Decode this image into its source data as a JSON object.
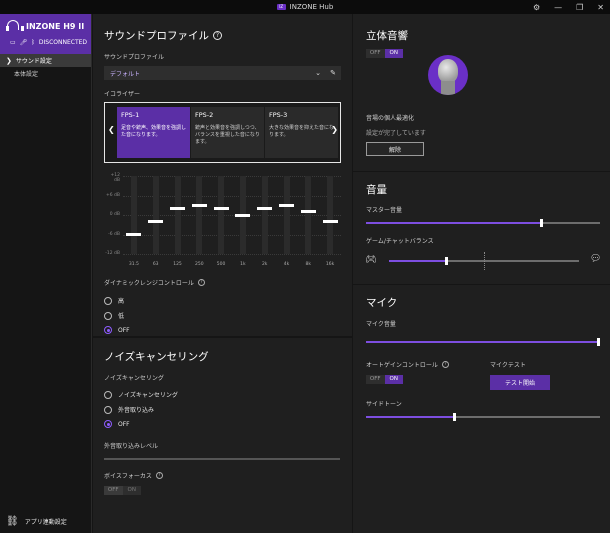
{
  "window": {
    "title": "INZONE Hub",
    "controls": [
      "⚙",
      "—",
      "❐",
      "✕"
    ]
  },
  "sidebar": {
    "device_name": "INZONE H9 II",
    "status": "DISCONNECTED",
    "nav": [
      {
        "label": "サウンド設定",
        "active": true
      },
      {
        "label": "本体設定",
        "active": false
      }
    ],
    "app_link": "アプリ連動設定"
  },
  "sound_profile": {
    "title": "サウンドプロファイル",
    "profile_label": "サウンドプロファイル",
    "profile_value": "デフォルト",
    "eq_label": "イコライザー",
    "presets": [
      {
        "name": "FPS-1",
        "desc": "足音や銃声、効果音を強調した音になります。",
        "active": true
      },
      {
        "name": "FPS-2",
        "desc": "銃声と効果音を強調しつつ、バランスを重視した音になります。",
        "active": false
      },
      {
        "name": "FPS-3",
        "desc": "大きな効果音を抑えた音になります。",
        "active": false
      }
    ],
    "eq": {
      "db_labels": [
        "+12 dB",
        "+6 dB",
        "0 dB",
        "-6 dB",
        "-12 dB"
      ],
      "bands": [
        {
          "freq": "31.5",
          "gain": -6
        },
        {
          "freq": "63",
          "gain": -2
        },
        {
          "freq": "125",
          "gain": 2
        },
        {
          "freq": "250",
          "gain": 3
        },
        {
          "freq": "500",
          "gain": 2
        },
        {
          "freq": "1k",
          "gain": 0
        },
        {
          "freq": "2k",
          "gain": 2
        },
        {
          "freq": "4k",
          "gain": 3
        },
        {
          "freq": "8k",
          "gain": 1
        },
        {
          "freq": "16k",
          "gain": -2
        }
      ]
    },
    "drc_label": "ダイナミックレンジコントロール",
    "drc_options": [
      {
        "label": "高",
        "checked": false
      },
      {
        "label": "低",
        "checked": false
      },
      {
        "label": "OFF",
        "checked": true
      }
    ]
  },
  "noise": {
    "title": "ノイズキャンセリング",
    "label": "ノイズキャンセリング",
    "options": [
      {
        "label": "ノイズキャンセリング",
        "checked": false
      },
      {
        "label": "外音取り込み",
        "checked": false
      },
      {
        "label": "OFF",
        "checked": true
      }
    ],
    "ambient_level_label": "外音取り込みレベル",
    "voice_focus_label": "ボイスフォーカス",
    "voice_focus": {
      "off": "OFF",
      "on": "ON",
      "enabled": false
    }
  },
  "spatial": {
    "title": "立体音響",
    "toggle": {
      "off": "OFF",
      "on": "ON",
      "enabled": true
    },
    "personal_label": "音場の個人最適化",
    "personal_status": "設定が完了しています",
    "cancel_button": "解除"
  },
  "volume": {
    "title": "音量",
    "master_label": "マスター音量",
    "master_level": 0.75,
    "balance_label": "ゲーム/チャットバランス",
    "balance_level": 0.3
  },
  "mic": {
    "title": "マイク",
    "volume_label": "マイク音量",
    "volume_level": 1.0,
    "agc_label": "オートゲインコントロール",
    "agc": {
      "off": "OFF",
      "on": "ON",
      "enabled": true
    },
    "test_label": "マイクテスト",
    "test_button": "テスト開始",
    "sidetone_label": "サイドトーン",
    "sidetone_level": 0.38
  },
  "colors": {
    "accent": "#5b2fa6",
    "slider": "#7d4ee0"
  }
}
